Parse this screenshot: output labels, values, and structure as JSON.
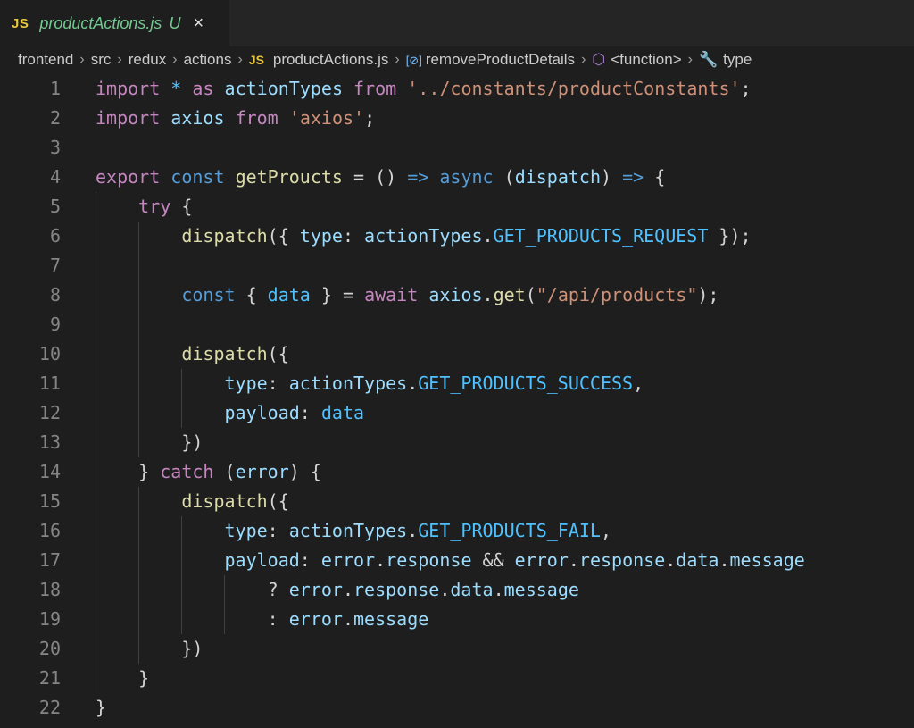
{
  "tab": {
    "icon": "JS",
    "filename": "productActions.js",
    "status": "U",
    "close_icon": "×"
  },
  "breadcrumb": [
    {
      "label": "frontend",
      "icon": ""
    },
    {
      "label": "src",
      "icon": ""
    },
    {
      "label": "redux",
      "icon": ""
    },
    {
      "label": "actions",
      "icon": ""
    },
    {
      "label": "productActions.js",
      "icon": "JS"
    },
    {
      "label": "removeProductDetails",
      "icon": "variable-icon"
    },
    {
      "label": "<function>",
      "icon": "function-cube-icon"
    },
    {
      "label": "type",
      "icon": "wrench-icon"
    }
  ],
  "code": {
    "lines": [
      [
        [
          "kw",
          "import"
        ],
        [
          "op",
          " "
        ],
        [
          "cn",
          "*"
        ],
        [
          "op",
          " "
        ],
        [
          "kw",
          "as"
        ],
        [
          "op",
          " "
        ],
        [
          "vr",
          "actionTypes"
        ],
        [
          "op",
          " "
        ],
        [
          "kw",
          "from"
        ],
        [
          "op",
          " "
        ],
        [
          "str",
          "'../constants/productConstants'"
        ],
        [
          "op",
          ";"
        ]
      ],
      [
        [
          "kw",
          "import"
        ],
        [
          "op",
          " "
        ],
        [
          "vr",
          "axios"
        ],
        [
          "op",
          " "
        ],
        [
          "kw",
          "from"
        ],
        [
          "op",
          " "
        ],
        [
          "str",
          "'axios'"
        ],
        [
          "op",
          ";"
        ]
      ],
      [],
      [
        [
          "kw",
          "export"
        ],
        [
          "op",
          " "
        ],
        [
          "st",
          "const"
        ],
        [
          "op",
          " "
        ],
        [
          "fn",
          "getProucts"
        ],
        [
          "op",
          " = () "
        ],
        [
          "st",
          "=>"
        ],
        [
          "op",
          " "
        ],
        [
          "st",
          "async"
        ],
        [
          "op",
          " ("
        ],
        [
          "vr",
          "dispatch"
        ],
        [
          "op",
          ") "
        ],
        [
          "st",
          "=>"
        ],
        [
          "op",
          " {"
        ]
      ],
      [
        [
          "op",
          "    "
        ],
        [
          "kw",
          "try"
        ],
        [
          "op",
          " {"
        ]
      ],
      [
        [
          "op",
          "        "
        ],
        [
          "fn",
          "dispatch"
        ],
        [
          "op",
          "({ "
        ],
        [
          "vr",
          "type"
        ],
        [
          "op",
          ": "
        ],
        [
          "vr",
          "actionTypes"
        ],
        [
          "op",
          "."
        ],
        [
          "cn",
          "GET_PRODUCTS_REQUEST"
        ],
        [
          "op",
          " });"
        ]
      ],
      [],
      [
        [
          "op",
          "        "
        ],
        [
          "st",
          "const"
        ],
        [
          "op",
          " { "
        ],
        [
          "cn",
          "data"
        ],
        [
          "op",
          " } = "
        ],
        [
          "kw",
          "await"
        ],
        [
          "op",
          " "
        ],
        [
          "vr",
          "axios"
        ],
        [
          "op",
          "."
        ],
        [
          "fn",
          "get"
        ],
        [
          "op",
          "("
        ],
        [
          "str",
          "\"/api/products\""
        ],
        [
          "op",
          ");"
        ]
      ],
      [],
      [
        [
          "op",
          "        "
        ],
        [
          "fn",
          "dispatch"
        ],
        [
          "op",
          "({"
        ]
      ],
      [
        [
          "op",
          "            "
        ],
        [
          "vr",
          "type"
        ],
        [
          "op",
          ": "
        ],
        [
          "vr",
          "actionTypes"
        ],
        [
          "op",
          "."
        ],
        [
          "cn",
          "GET_PRODUCTS_SUCCESS"
        ],
        [
          "op",
          ","
        ]
      ],
      [
        [
          "op",
          "            "
        ],
        [
          "vr",
          "payload"
        ],
        [
          "op",
          ": "
        ],
        [
          "cn",
          "data"
        ]
      ],
      [
        [
          "op",
          "        })"
        ]
      ],
      [
        [
          "op",
          "    } "
        ],
        [
          "kw",
          "catch"
        ],
        [
          "op",
          " ("
        ],
        [
          "vr",
          "error"
        ],
        [
          "op",
          ") {"
        ]
      ],
      [
        [
          "op",
          "        "
        ],
        [
          "fn",
          "dispatch"
        ],
        [
          "op",
          "({"
        ]
      ],
      [
        [
          "op",
          "            "
        ],
        [
          "vr",
          "type"
        ],
        [
          "op",
          ": "
        ],
        [
          "vr",
          "actionTypes"
        ],
        [
          "op",
          "."
        ],
        [
          "cn",
          "GET_PRODUCTS_FAIL"
        ],
        [
          "op",
          ","
        ]
      ],
      [
        [
          "op",
          "            "
        ],
        [
          "vr",
          "payload"
        ],
        [
          "op",
          ": "
        ],
        [
          "vr",
          "error"
        ],
        [
          "op",
          "."
        ],
        [
          "vr",
          "response"
        ],
        [
          "op",
          " && "
        ],
        [
          "vr",
          "error"
        ],
        [
          "op",
          "."
        ],
        [
          "vr",
          "response"
        ],
        [
          "op",
          "."
        ],
        [
          "vr",
          "data"
        ],
        [
          "op",
          "."
        ],
        [
          "vr",
          "message"
        ]
      ],
      [
        [
          "op",
          "                ? "
        ],
        [
          "vr",
          "error"
        ],
        [
          "op",
          "."
        ],
        [
          "vr",
          "response"
        ],
        [
          "op",
          "."
        ],
        [
          "vr",
          "data"
        ],
        [
          "op",
          "."
        ],
        [
          "vr",
          "message"
        ]
      ],
      [
        [
          "op",
          "                : "
        ],
        [
          "vr",
          "error"
        ],
        [
          "op",
          "."
        ],
        [
          "vr",
          "message"
        ]
      ],
      [
        [
          "op",
          "        })"
        ]
      ],
      [
        [
          "op",
          "    }"
        ]
      ],
      [
        [
          "op",
          "}"
        ]
      ]
    ],
    "line_numbers": [
      "1",
      "2",
      "3",
      "4",
      "5",
      "6",
      "7",
      "8",
      "9",
      "10",
      "11",
      "12",
      "13",
      "14",
      "15",
      "16",
      "17",
      "18",
      "19",
      "20",
      "21",
      "22"
    ]
  }
}
